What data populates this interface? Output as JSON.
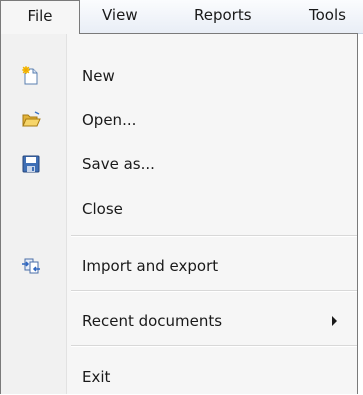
{
  "menubar": {
    "items": [
      {
        "label": "File"
      },
      {
        "label": "View"
      },
      {
        "label": "Reports"
      },
      {
        "label": "Tools"
      }
    ]
  },
  "file_menu": {
    "new": {
      "label": "New",
      "icon": "new-document-icon"
    },
    "open": {
      "label": "Open...",
      "icon": "open-folder-icon"
    },
    "save_as": {
      "label": "Save as...",
      "icon": "floppy-disk-icon"
    },
    "close": {
      "label": "Close"
    },
    "import_export": {
      "label": "Import and export",
      "icon": "import-export-icon"
    },
    "recent": {
      "label": "Recent documents",
      "icon": "submenu-arrow-icon"
    },
    "exit": {
      "label": "Exit"
    }
  },
  "colors": {
    "menu_border": "#7a7a7a",
    "menu_background": "#f6f6f6",
    "bar_background": "#e9eef6"
  }
}
